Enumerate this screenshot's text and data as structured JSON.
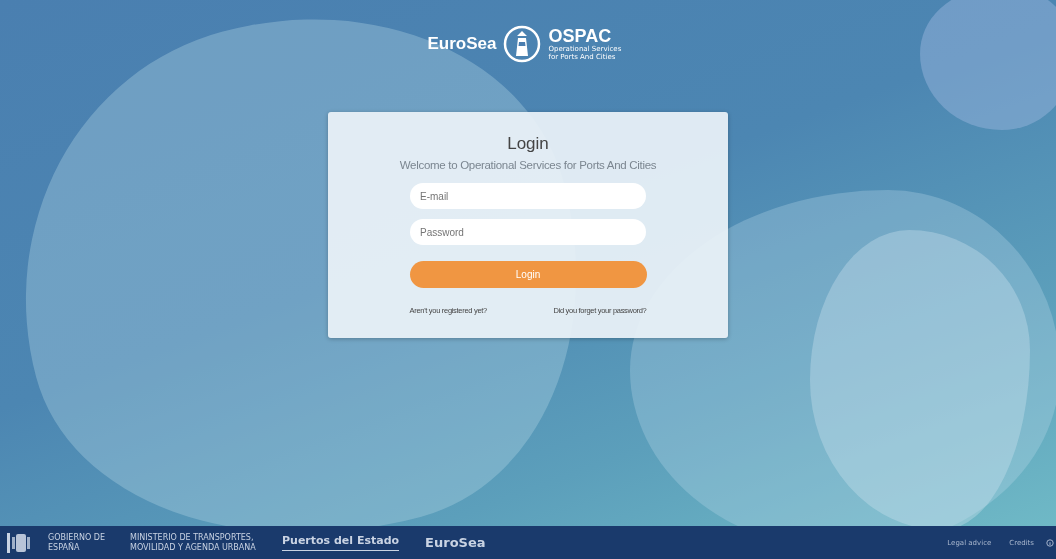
{
  "header": {
    "logo_left": "EuroSea",
    "logo_right": "OSPAC",
    "logo_right_subtitle": "Operational Services for Ports And Cities"
  },
  "login": {
    "title": "Login",
    "subtitle": "Welcome to Operational Services for Ports And Cities",
    "fields": [
      {
        "placeholder": "E-mail"
      },
      {
        "placeholder": "Password"
      }
    ],
    "button": "Login",
    "links": [
      "Aren't you registered yet?",
      "Did you forget your password?"
    ]
  },
  "footer": {
    "gov": "GOBIERNO DE ESPAÑA",
    "ministry": "MINISTERIO DE TRANSPORTES, MOVILIDAD Y AGENDA URBANA",
    "ports": "Puertos del Estado",
    "eurosea": "EuroSea",
    "links": [
      "Legal advice",
      "Credits"
    ]
  }
}
